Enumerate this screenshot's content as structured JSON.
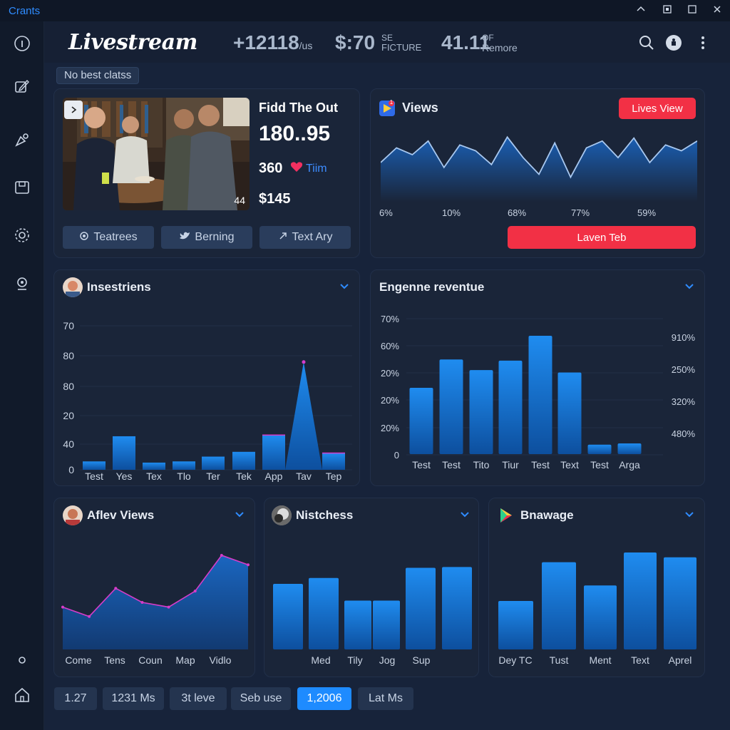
{
  "titlebar": {
    "app_name": "Crants"
  },
  "header": {
    "logo": "Livestream",
    "stat1_value": "+12118",
    "stat1_unit": "/us",
    "stat2_value": "$:70",
    "stat2_unit_top": "SE",
    "stat2_unit_bottom": "FICTURE",
    "stat3_value": "41.11",
    "stat3_unit_top": "OF",
    "stat3_unit_bottom": "Remore"
  },
  "filter_chip": "No best clatss",
  "stream_card": {
    "title": "Fidd The Out",
    "amount": "180..95",
    "likes": "360",
    "likes_label": "Tiim",
    "price": "$145",
    "photo_counter": "44",
    "buttons": [
      "Teatrees",
      "Berning",
      "Text Ary"
    ]
  },
  "views_card": {
    "title": "Views",
    "live_button": "Lives View",
    "action_button": "Laven Teb",
    "badge": "1",
    "chart_data": {
      "type": "line",
      "x_labels": [
        "6%",
        "10%",
        "68%",
        "77%",
        "59%"
      ],
      "values": [
        40,
        55,
        48,
        62,
        35,
        58,
        52,
        38,
        66,
        45,
        28,
        60,
        25,
        55,
        62,
        45,
        65,
        40,
        58,
        52,
        62
      ]
    }
  },
  "insestriens_card": {
    "title": "Insestriens",
    "chart_data": {
      "type": "bar",
      "categories": [
        "Test",
        "Yes",
        "Tex",
        "Tlo",
        "Ter",
        "Tek",
        "App",
        "Tav",
        "Tep"
      ],
      "y_tick_labels": [
        "70",
        "80",
        "80",
        "20",
        "40",
        "0"
      ],
      "values": [
        7,
        28,
        6,
        7,
        11,
        15,
        29,
        90,
        14
      ]
    }
  },
  "engine_card": {
    "title": "Engenne reventue",
    "chart_data": {
      "type": "bar",
      "categories": [
        "Test",
        "Test",
        "Tito",
        "Tiur",
        "Test",
        "Text",
        "Test",
        "Arga"
      ],
      "y_tick_labels": [
        "70%",
        "60%",
        "20%",
        "20%",
        "20%",
        "0"
      ],
      "right_labels": [
        "910%",
        "250%",
        "320%",
        "480%"
      ],
      "values": [
        56,
        80,
        71,
        79,
        100,
        69,
        8,
        9
      ]
    }
  },
  "aflev_card": {
    "title": "Aflev Views",
    "chart_data": {
      "type": "area",
      "categories": [
        "Come",
        "Tens",
        "Coun",
        "Map",
        "Vidlo"
      ],
      "values": [
        45,
        35,
        65,
        50,
        45,
        62,
        100,
        90
      ]
    }
  },
  "nitschess_card": {
    "title": "Nistchess",
    "chart_data": {
      "type": "bar",
      "categories": [
        "Med",
        "Tily",
        "Jog",
        "Sup"
      ],
      "values": [
        78,
        85,
        58,
        58,
        97,
        98
      ]
    }
  },
  "bnawage_card": {
    "title": "Bnawage",
    "chart_data": {
      "type": "bar",
      "categories": [
        "Dey TC",
        "Tust",
        "Ment",
        "Text",
        "Aprel"
      ],
      "values": [
        50,
        90,
        66,
        100,
        95
      ]
    }
  },
  "footer": {
    "buttons": [
      "1.27",
      "1231 Ms",
      "3t leve",
      "Seb use",
      "1,2006",
      "Lat Ms"
    ],
    "active_index": 4
  },
  "colors": {
    "accent": "#1e8bff",
    "alert": "#f23045",
    "bar": "#1570d6",
    "bar_top": "#1f8cf0",
    "highlight_line": "#d63cc9"
  }
}
